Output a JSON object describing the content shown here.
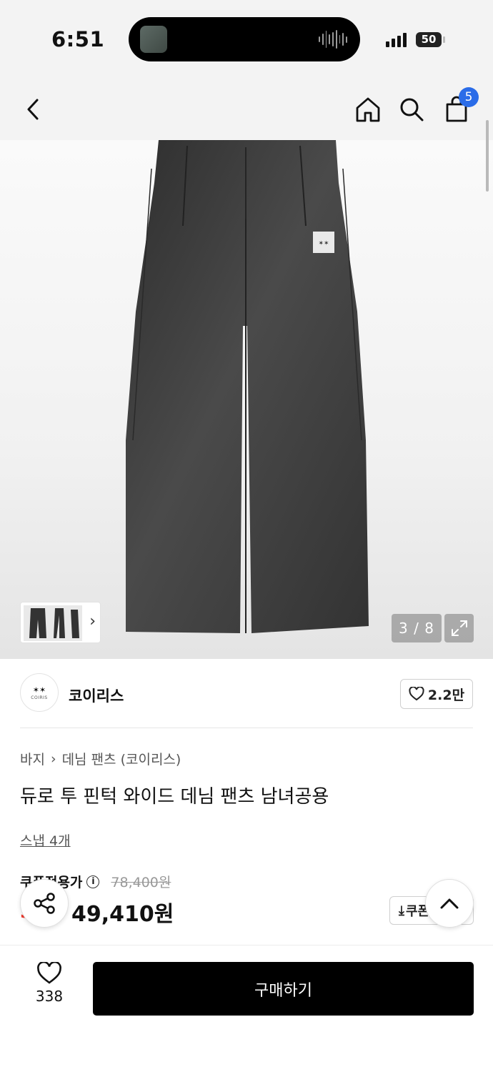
{
  "status_bar": {
    "time": "6:51",
    "battery": "50"
  },
  "nav": {
    "cart_count": "5",
    "icons": [
      "back-icon",
      "home-icon",
      "search-icon",
      "shopping-bag-icon"
    ]
  },
  "gallery": {
    "page_indicator": "3 / 8",
    "product_colors": {
      "denim": "#3a3a3a",
      "badge": "#2a6ce8"
    }
  },
  "brand": {
    "name": "코이리스",
    "logo_text": "COIRIS",
    "like_count": "2.2만"
  },
  "product": {
    "breadcrumb": [
      "바지",
      "데님 팬츠 (코이리스)"
    ],
    "title": "듀로 투 핀턱 와이드 데님 팬츠 남녀공용",
    "snap_link": "스냅 4개",
    "price_label": "쿠폰적용가",
    "original_price": "78,400원",
    "discount": "3",
    "final_price": "49,410원",
    "coupon_button": "쿠폰"
  },
  "bottom_bar": {
    "like_count": "338",
    "buy_label": "구매하기"
  }
}
